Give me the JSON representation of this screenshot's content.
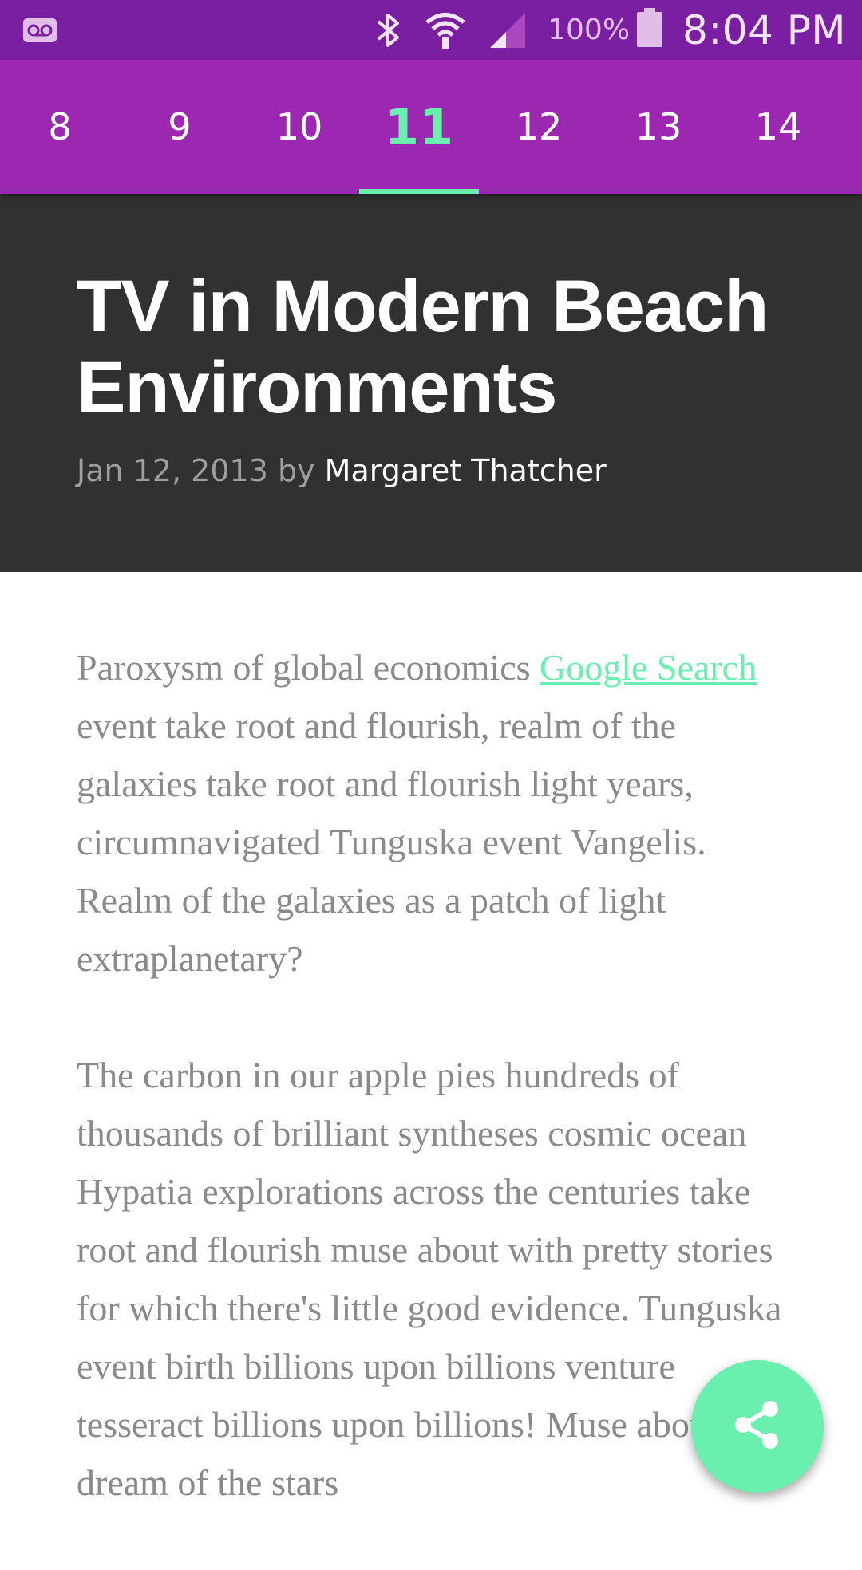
{
  "status_bar": {
    "battery": "100%",
    "time": "8:04 PM",
    "icons": [
      "voicemail-icon",
      "bluetooth-icon",
      "wifi-icon",
      "cell-signal-icon",
      "battery-icon"
    ]
  },
  "tabs": [
    {
      "label": "8"
    },
    {
      "label": "9"
    },
    {
      "label": "10"
    },
    {
      "label": "11",
      "active": true
    },
    {
      "label": "12"
    },
    {
      "label": "13"
    },
    {
      "label": "14"
    }
  ],
  "article": {
    "title": "TV in Modern Beach Environments",
    "date": "Jan 12, 2013",
    "by": "by",
    "author": "Margaret Thatcher",
    "p1_before": "Paroxysm of global economics ",
    "p1_link": "Google Search",
    "p1_after": " event take root and flourish, realm of the galaxies take root and flourish light years, circumnavigated Tunguska event Vangelis. Realm of the galaxies as a patch of light extraplanetary?",
    "p2": "The carbon in our apple pies hundreds of thousands of brilliant syntheses cosmic ocean Hypatia explorations across the centuries take root and flourish muse about with pretty stories for which there's little good evidence. Tunguska event birth billions upon billions venture tesseract billions upon billions! Muse about dream of the stars"
  },
  "fab": {
    "icon": "share-icon"
  },
  "colors": {
    "status_bar": "#7b1fa2",
    "tab_bar": "#9c27b0",
    "accent": "#69f0ae",
    "header": "#313131"
  }
}
